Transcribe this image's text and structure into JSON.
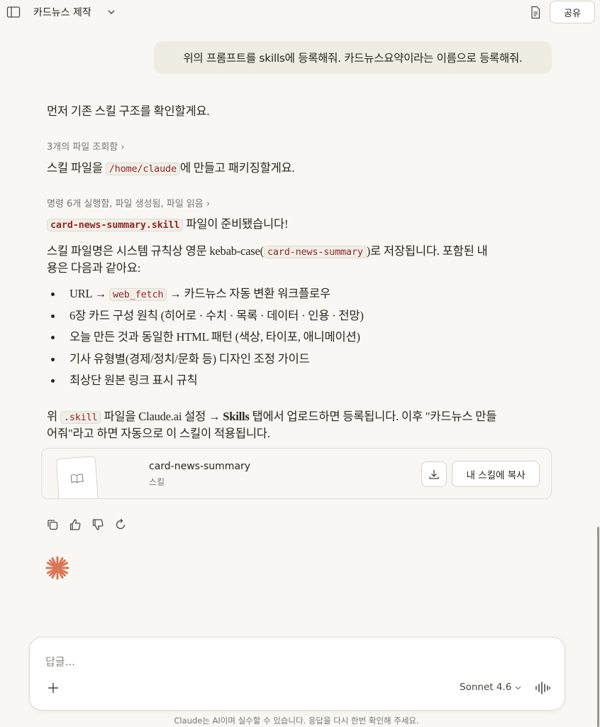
{
  "header": {
    "title": "카드뉴스 제작",
    "share_label": "공유"
  },
  "user_message": "위의 프롬프트를 skills에 등록해줘. 카드뉴스요약이라는 이름으로 등록해줘.",
  "assistant": {
    "p1": "먼저 기존 스킬 구조를 확인할게요.",
    "meta1": "3개의 파일 조회함 ›",
    "p2_before": "스킬 파일을 ",
    "p2_code": "/home/claude",
    "p2_after": "에 만들고 패키징할게요.",
    "meta2": "명령 6개 실행함, 파일 생성됨, 파일 읽음 ›",
    "p3_code": "card-news-summary.skill",
    "p3_after": " 파일이 준비됐습니다!",
    "p4_line1_before": "스킬 파일명은 시스템 규칙상 영문 kebab-case(",
    "p4_code": "card-news-summary",
    "p4_line1_after": ")로 저장됩니다. 포함된 내",
    "p4_line2": "용은 다음과 같아요:",
    "bullet1_before": "URL → ",
    "bullet1_code": "web_fetch",
    "bullet1_after": " → 카드뉴스 자동 변환 워크플로우",
    "bullet2": "6장 카드 구성 원칙 (히어로 · 수치 · 목록 · 데이터 · 인용 · 전망)",
    "bullet3": "오늘 만든 것과 동일한 HTML 패턴 (색상, 타이포, 애니메이션)",
    "bullet4": "기사 유형별(경제/정치/문화 등) 디자인 조정 가이드",
    "bullet5": "최상단 원본 링크 표시 규칙",
    "p5_a": "위 ",
    "p5_code": ".skill",
    "p5_b": " 파일을 Claude.ai 설정 → ",
    "p5_bold": "Skills",
    "p5_c": " 탭에서 업로드하면 등록됩니다. 이후 \"카드뉴스 만들",
    "p5_line2": "어줘\"라고 하면 자동으로 이 스킬이 적용됩니다."
  },
  "file_card": {
    "name": "card-news-summary",
    "type": "스킬",
    "copy_label": "내 스킬에 복사"
  },
  "composer": {
    "placeholder": "답글...",
    "model": "Sonnet 4.6"
  },
  "disclaimer": "Claude는 AI이며 실수할 수 있습니다. 응답을 다시 한번 확인해 주세요.",
  "colors": {
    "background": "#f8f7f3",
    "code_text": "#8b2a2a",
    "claude_orange": "#d97757"
  }
}
